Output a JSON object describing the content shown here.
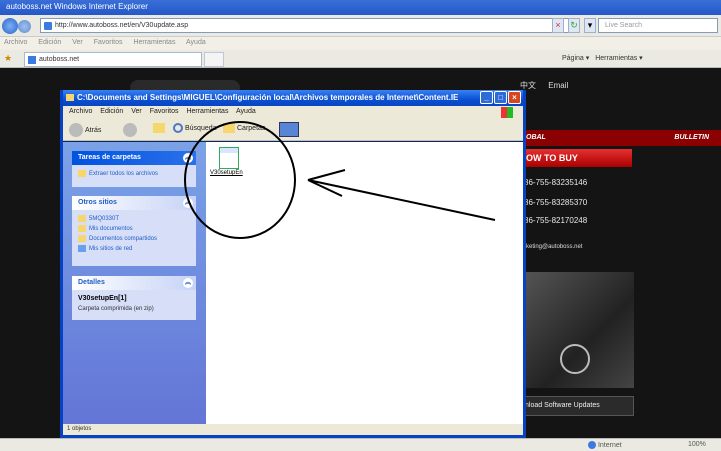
{
  "ie": {
    "title": "autoboss.net   Windows Internet Explorer",
    "address": "http://www.autoboss.net/en/V30update.asp",
    "search_placeholder": "Live Search",
    "menu": [
      "Archivo",
      "Edición",
      "Ver",
      "Favoritos",
      "Herramientas",
      "Ayuda"
    ],
    "tab_label": "autoboss.net",
    "commands": [
      "Página ▾",
      "Herramientas ▾"
    ],
    "status_zone": "Internet",
    "zoom": "100%"
  },
  "site": {
    "top_links": [
      "中文",
      "Email"
    ],
    "nav": [
      "OBAL",
      "BULLETIN"
    ],
    "how_to_buy": "OW TO BUY",
    "phones": [
      "86-755-83235146",
      "86-755-83285370",
      "86-755-82170248"
    ],
    "email": "rketing@autoboss.net",
    "download": "nload Software Updates"
  },
  "explorer": {
    "title": "C:\\Documents and Settings\\MIGUEL\\Configuración local\\Archivos temporales de Internet\\Content.IE",
    "menu": [
      "Archivo",
      "Edición",
      "Ver",
      "Favoritos",
      "Herramientas",
      "Ayuda"
    ],
    "toolbar": {
      "back": "Atrás",
      "search": "Búsqueda",
      "folders": "Carpetas"
    },
    "tasks": {
      "title": "Tareas de carpetas",
      "items": [
        "Extraer todos los archivos"
      ]
    },
    "places": {
      "title": "Otros sitios",
      "items": [
        "5MQ0330T",
        "Mis documentos",
        "Documentos compartidos",
        "Mis sitios de red"
      ]
    },
    "details": {
      "title": "Detalles",
      "name": "V30setupEn[1]",
      "type": "Carpeta comprimida (en zip)"
    },
    "file_label": "V30setupEn",
    "status": "1 objetos"
  }
}
